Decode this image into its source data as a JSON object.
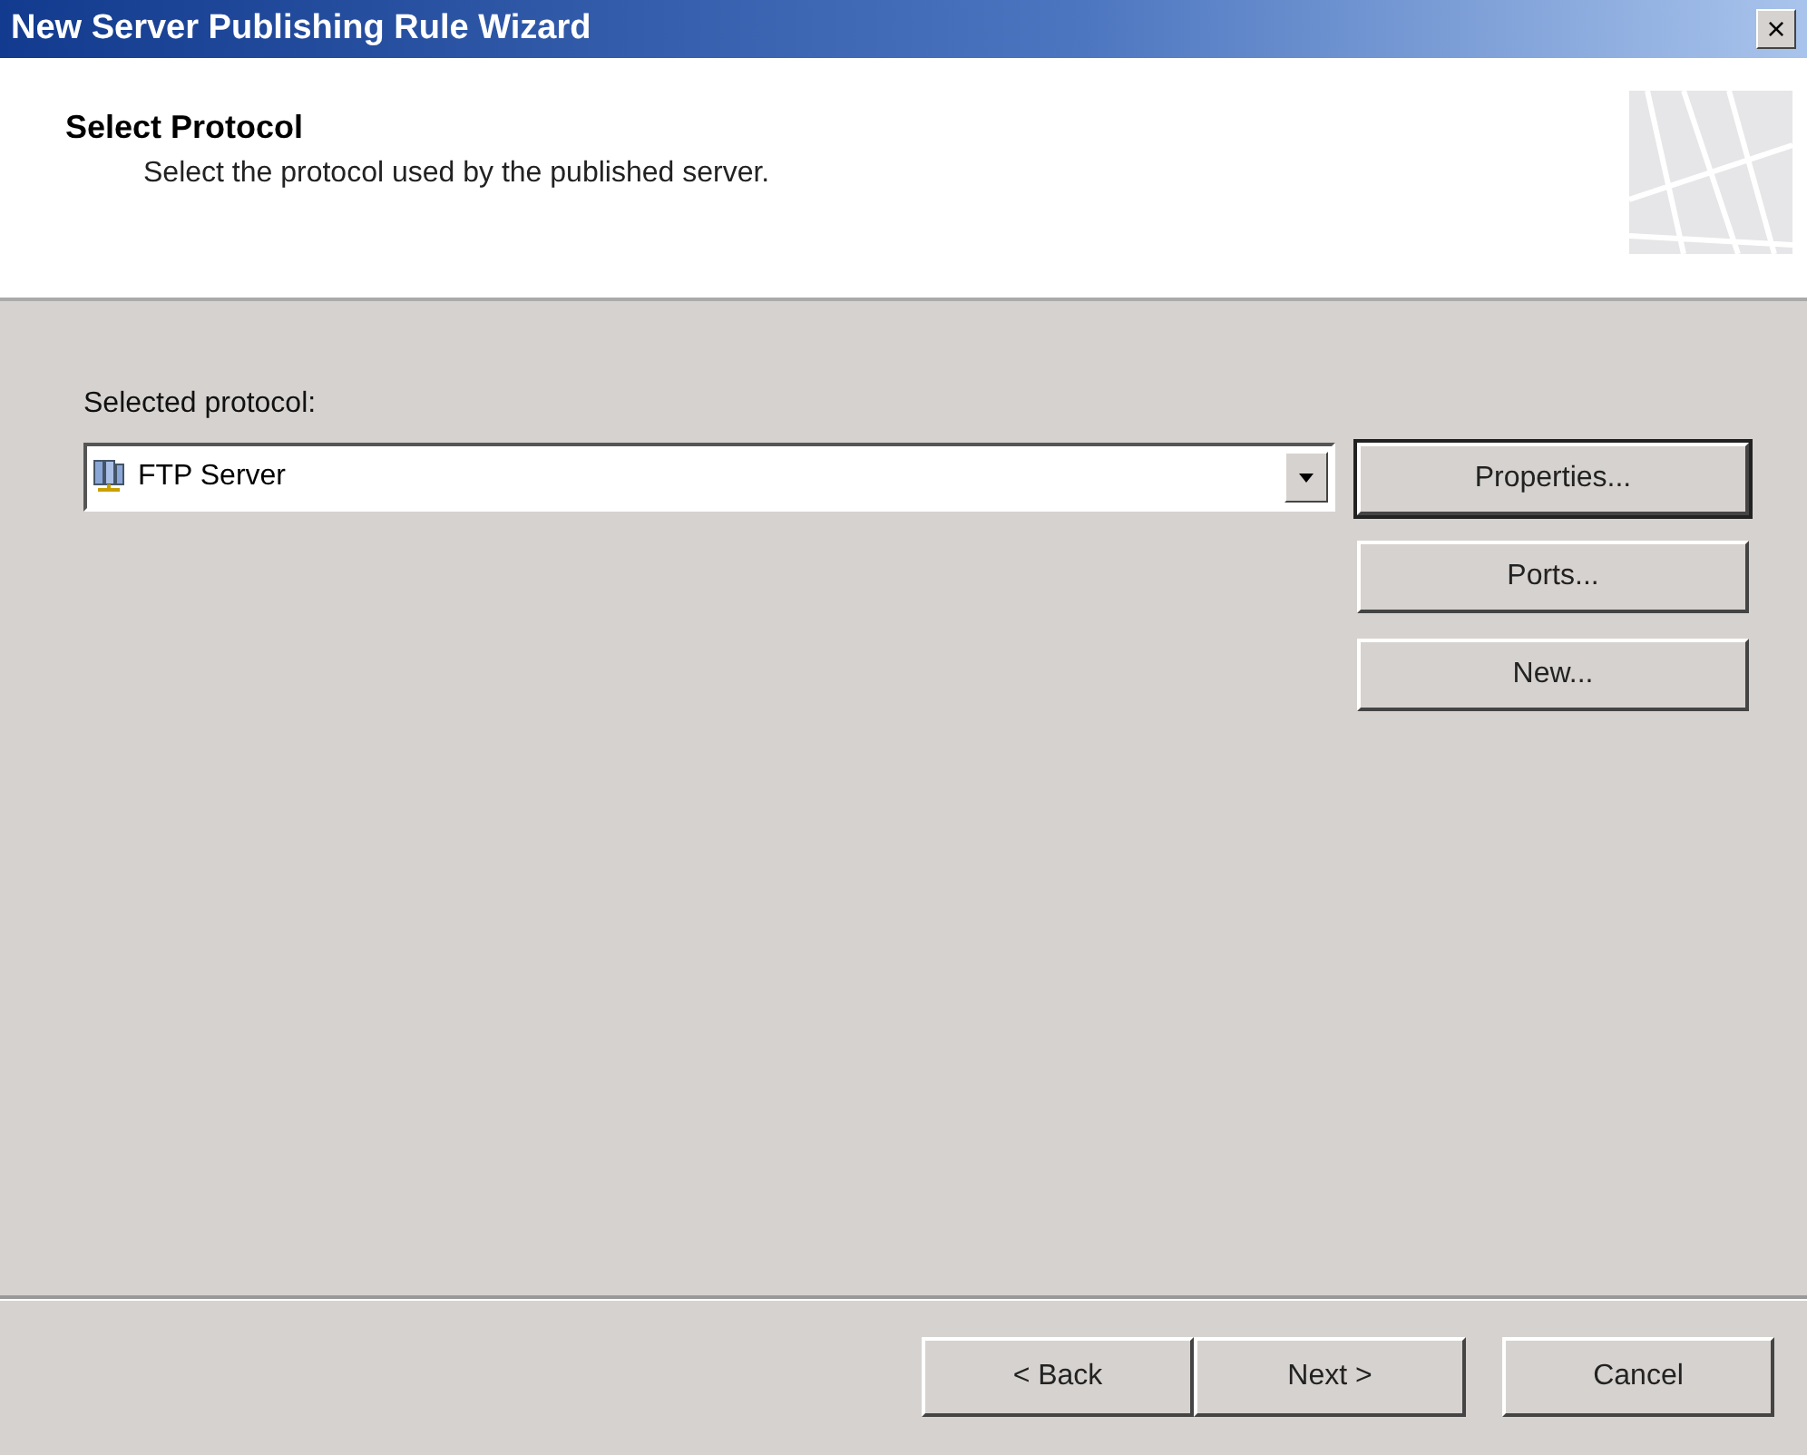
{
  "window": {
    "title": "New Server Publishing Rule Wizard",
    "close": "×"
  },
  "header": {
    "title": "Select Protocol",
    "subtitle": "Select the protocol used by the published server."
  },
  "protocol": {
    "label": "Selected protocol:",
    "value": "FTP Server"
  },
  "side_buttons": [
    {
      "label": "Properties...",
      "default": true
    },
    {
      "label": "Ports...",
      "default": false
    },
    {
      "label": "New...",
      "default": false
    }
  ],
  "footer_buttons": [
    {
      "label": "< Back"
    },
    {
      "label": "Next >"
    },
    {
      "label": "Cancel"
    }
  ]
}
